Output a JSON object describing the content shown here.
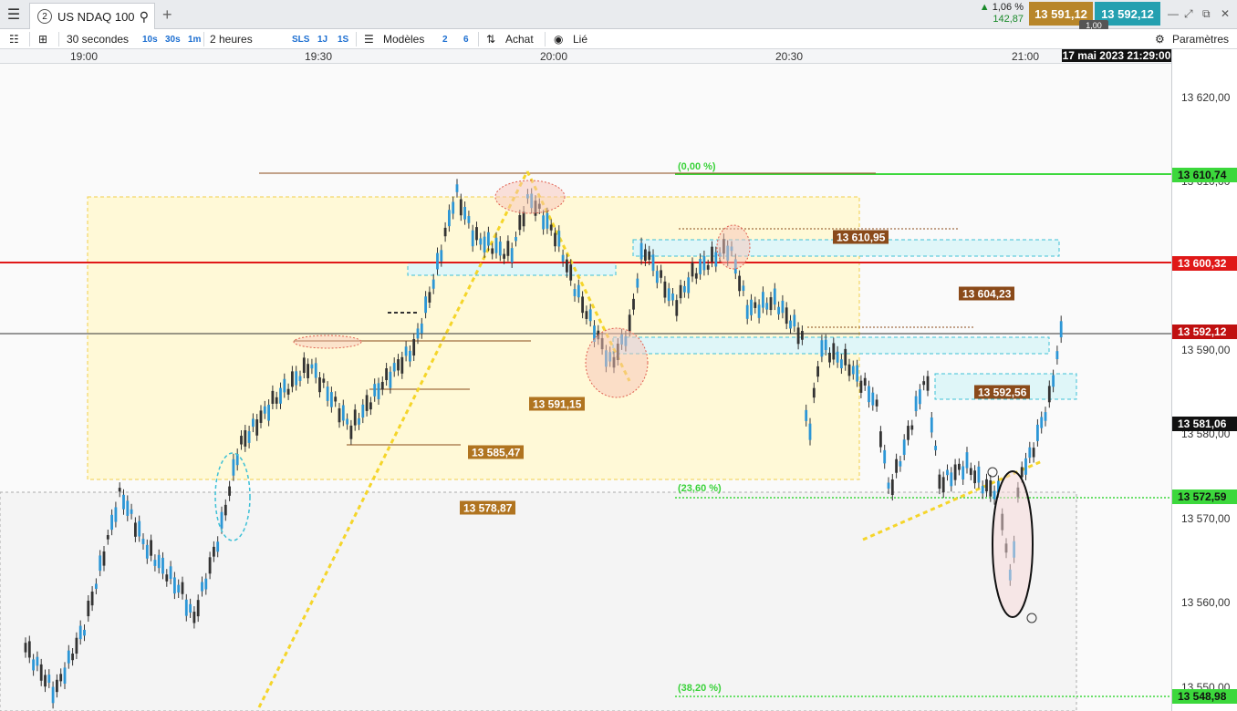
{
  "tab": {
    "number": "2",
    "title": "US NDAQ 100"
  },
  "quote": {
    "change_pct": "1,06 %",
    "change_abs": "142,87",
    "bid": "13 591,12",
    "ask": "13 592,12",
    "lot": "1,00"
  },
  "toolbar": {
    "interval": "30 secondes",
    "interval_shortcuts": [
      "10s",
      "30s",
      "1m"
    ],
    "range": "2 heures",
    "range_shortcuts": [
      "SLS",
      "1J",
      "1S"
    ],
    "models_label": "Modèles",
    "num_a": "2",
    "num_b": "6",
    "buy_label": "Achat",
    "linked_label": "Lié",
    "settings_label": "Paramètres"
  },
  "time_axis": {
    "labels": [
      "19:00",
      "19:30",
      "20:00",
      "20:30",
      "21:00"
    ],
    "cursor": "17 mai 2023 21:29:00"
  },
  "price_axis": {
    "labels": [
      "13 620,00",
      "13 610,00",
      "13 590,00",
      "13 580,00",
      "13 570,00",
      "13 560,00",
      "13 550,00"
    ],
    "tags": [
      {
        "text": "13 610,74",
        "bg": "#3cd83c",
        "fg": "#111"
      },
      {
        "text": "13 600,32",
        "bg": "#e01818",
        "fg": "#fff"
      },
      {
        "text": "13 592,12",
        "bg": "#c01010",
        "fg": "#fff"
      },
      {
        "text": "13 581,06",
        "bg": "#111111",
        "fg": "#fff"
      },
      {
        "text": "13 572,59",
        "bg": "#3cd83c",
        "fg": "#111"
      },
      {
        "text": "13 548,98",
        "bg": "#3cd83c",
        "fg": "#111"
      }
    ]
  },
  "chart_labels": {
    "fib": [
      "(0,00 %)",
      "(23,60 %)",
      "(38,20 %)"
    ],
    "levels": [
      "13 610,95",
      "13 604,23",
      "13 592,56",
      "13 591,15",
      "13 585,47",
      "13 578,87"
    ]
  },
  "colors": {
    "candle": "#2c96d6",
    "bid_bg": "#b8862a",
    "ask_bg": "#24a0b0",
    "support": "#3cd83c",
    "resistance": "#e01818"
  }
}
